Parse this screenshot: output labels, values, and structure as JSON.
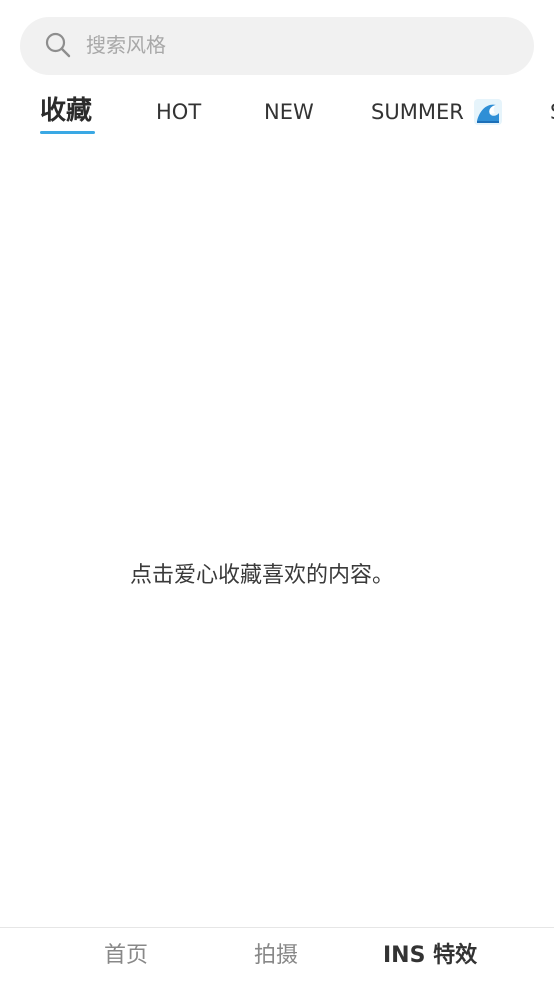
{
  "search": {
    "placeholder": "搜索风格",
    "icon": "search-icon"
  },
  "tabs": [
    {
      "label": "收藏",
      "active": true
    },
    {
      "label": "HOT",
      "active": false
    },
    {
      "label": "NEW",
      "active": false
    },
    {
      "label": "SUMMER",
      "active": false,
      "icon": "wave-icon"
    },
    {
      "label": "S",
      "active": false
    }
  ],
  "colors": {
    "accent": "#3aa8e4",
    "search_bg": "#f1f1f1",
    "text": "#333333",
    "muted": "#888888"
  },
  "empty_state": {
    "message": "点击爱心收藏喜欢的内容。"
  },
  "bottom_nav": {
    "items": [
      {
        "label": "首页",
        "active": false
      },
      {
        "label": "拍摄",
        "active": false
      },
      {
        "label": "INS 特效",
        "active": true
      }
    ]
  }
}
